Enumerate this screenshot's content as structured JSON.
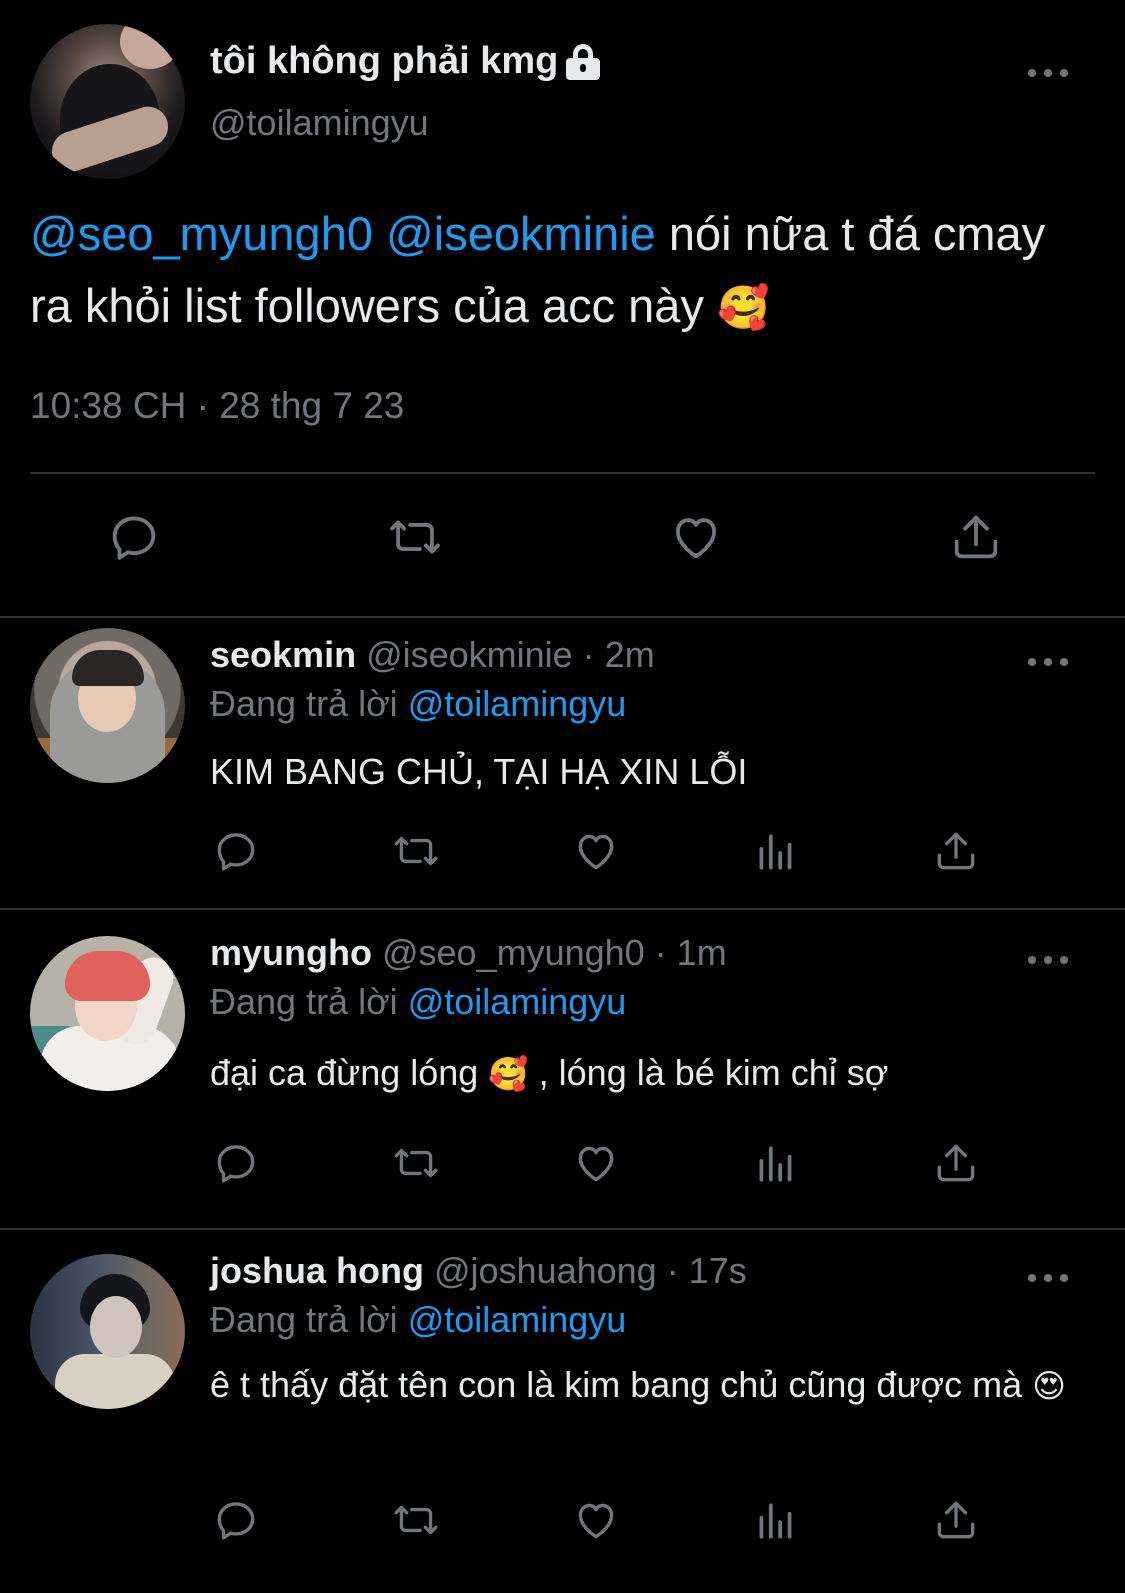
{
  "main_tweet": {
    "display_name": "tôi không phải kmg",
    "handle": "@toilamingyu",
    "text_mention_1": "@seo_myungh0",
    "text_mention_2": "@iseokminie",
    "text_body": " nói nữa t đá cmay ra khỏi list followers của acc này ",
    "text_emoji": "🥰",
    "timestamp": "10:38 CH · 28 thg 7 23",
    "lock_icon": "lock-icon"
  },
  "replying_prefix": "Đang trả lời ",
  "replies": [
    {
      "name": "seokmin",
      "meta": " @iseokminie · 2m",
      "replying_to": "@toilamingyu",
      "text": "KIM BANG CHỦ, TẠI HẠ XIN LỖI"
    },
    {
      "name": "myungho",
      "meta": " @seo_myungh0 · 1m",
      "replying_to": "@toilamingyu",
      "text_a": "đại ca đừng lóng ",
      "text_emoji": "🥰",
      "text_b": " , lóng là bé kim chỉ sợ"
    },
    {
      "name": "joshua hong",
      "meta": " @joshuahong · 17s",
      "replying_to": "@toilamingyu",
      "text_a": "ê t thấy đặt tên con là kim bang chủ cũng được mà ",
      "text_emoji": "😍"
    }
  ],
  "icons": {
    "reply": "reply-icon",
    "retweet": "retweet-icon",
    "like": "heart-icon",
    "views": "views-icon",
    "share": "share-icon",
    "more": "more-icon"
  },
  "colors": {
    "background": "#000000",
    "text": "#e7e9ea",
    "secondary": "#71767b",
    "mention": "#1d9bf0",
    "divider": "#2f3336"
  }
}
